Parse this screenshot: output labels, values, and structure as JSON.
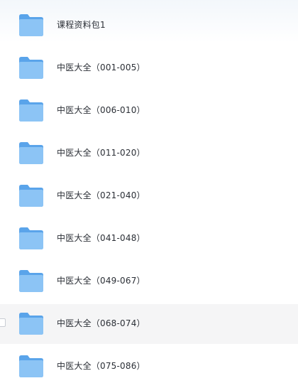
{
  "folders": [
    {
      "name": "课程资料包1",
      "hovered": false
    },
    {
      "name": "中医大全（001-005）",
      "hovered": false
    },
    {
      "name": "中医大全（006-010）",
      "hovered": false
    },
    {
      "name": "中医大全（011-020）",
      "hovered": false
    },
    {
      "name": "中医大全（021-040）",
      "hovered": false
    },
    {
      "name": "中医大全（041-048）",
      "hovered": false
    },
    {
      "name": "中医大全（049-067）",
      "hovered": false
    },
    {
      "name": "中医大全（068-074）",
      "hovered": true
    },
    {
      "name": "中医大全（075-086）",
      "hovered": false
    }
  ],
  "icon": "folder-icon",
  "colors": {
    "folder_back": "#5aa4ea",
    "folder_front": "#8cc4f5",
    "hover_bg": "#f5f5f6",
    "text": "#2b2f36"
  }
}
